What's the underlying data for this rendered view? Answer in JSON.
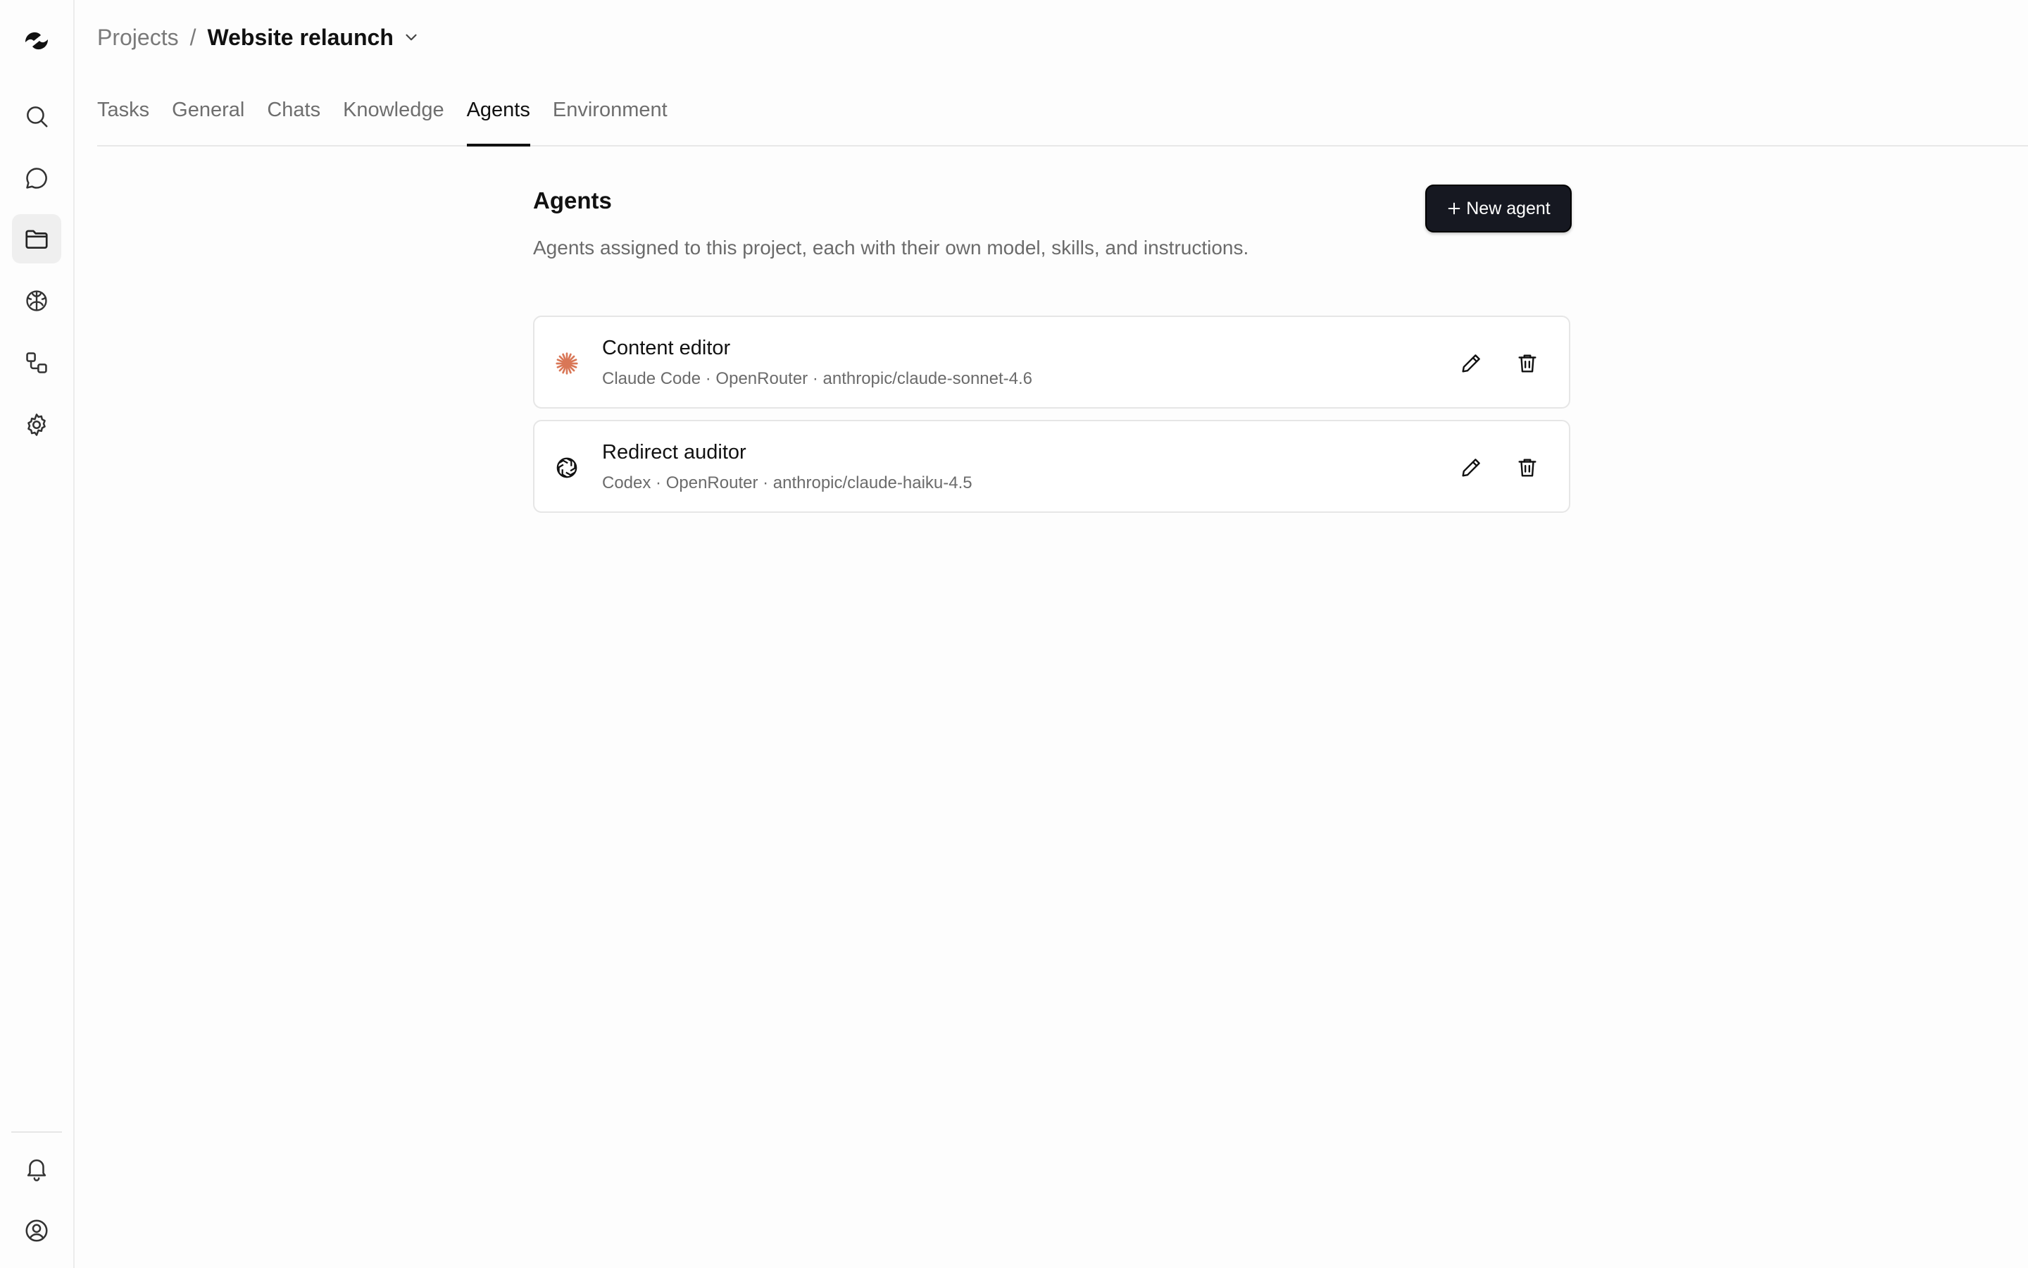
{
  "breadcrumb": {
    "parent": "Projects",
    "separator": "/",
    "current": "Website relaunch"
  },
  "tabs": [
    {
      "label": "Tasks",
      "active": false
    },
    {
      "label": "General",
      "active": false
    },
    {
      "label": "Chats",
      "active": false
    },
    {
      "label": "Knowledge",
      "active": false
    },
    {
      "label": "Agents",
      "active": true
    },
    {
      "label": "Environment",
      "active": false
    }
  ],
  "sidebar": {
    "items": [
      {
        "icon": "search-icon"
      },
      {
        "icon": "chat-bubble-icon"
      },
      {
        "icon": "folder-icon",
        "active": true
      },
      {
        "icon": "brain-icon"
      },
      {
        "icon": "workflow-icon"
      },
      {
        "icon": "gear-icon"
      }
    ],
    "bottom_items": [
      {
        "icon": "bell-icon"
      },
      {
        "icon": "user-circle-icon"
      }
    ]
  },
  "main": {
    "title": "Agents",
    "description": "Agents assigned to this project, each with their own model, skills, and instructions.",
    "new_agent_label": "New agent",
    "agents": [
      {
        "name": "Content editor",
        "meta": "Claude Code · OpenRouter · anthropic/claude-sonnet-4.6",
        "icon": "claude-asterisk-icon",
        "icon_color": "#d97757"
      },
      {
        "name": "Redirect auditor",
        "meta": "Codex · OpenRouter · anthropic/claude-haiku-4.5",
        "icon": "openai-knot-icon",
        "icon_color": "#111111"
      }
    ]
  },
  "colors": {
    "primary_button": "#161821",
    "active_tab_underline": "#111111",
    "muted_text": "#6b6b6b"
  }
}
